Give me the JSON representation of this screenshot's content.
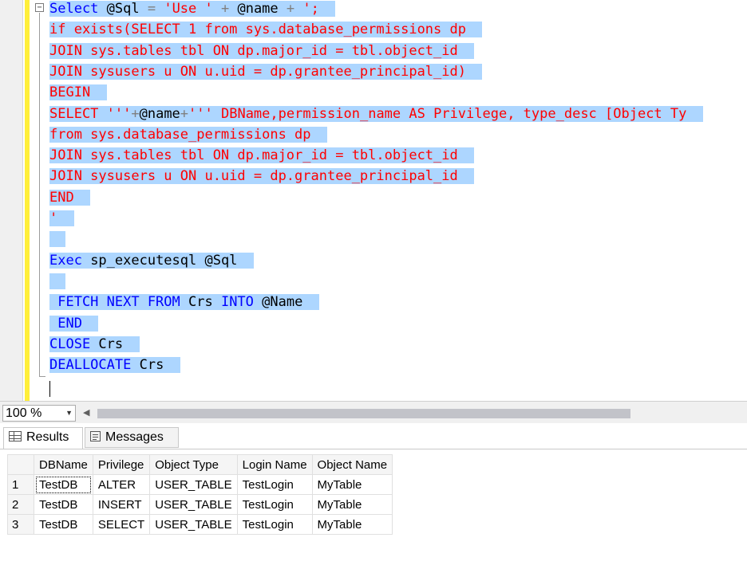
{
  "editor": {
    "outline_toggle": "−",
    "lines": [
      [
        {
          "t": "Select",
          "c": "kw"
        },
        {
          "t": " @Sql ",
          "c": "id"
        },
        {
          "t": "=",
          "c": "op"
        },
        {
          "t": " 'Use ' ",
          "c": "str"
        },
        {
          "t": "+",
          "c": "op"
        },
        {
          "t": " @name ",
          "c": "id"
        },
        {
          "t": "+",
          "c": "op"
        },
        {
          "t": " ';",
          "c": "str"
        }
      ],
      [
        {
          "t": "if exists(SELECT 1 from sys.database_permissions dp",
          "c": "str"
        }
      ],
      [
        {
          "t": "JOIN sys.tables tbl ON dp.major_id = tbl.object_id",
          "c": "str"
        }
      ],
      [
        {
          "t": "JOIN sysusers u ON u.uid = dp.grantee_principal_id)",
          "c": "str"
        }
      ],
      [
        {
          "t": "BEGIN",
          "c": "str"
        }
      ],
      [
        {
          "t": "SELECT '''",
          "c": "str"
        },
        {
          "t": "+",
          "c": "op"
        },
        {
          "t": "@name",
          "c": "id"
        },
        {
          "t": "+",
          "c": "op"
        },
        {
          "t": "''' DBName,permission_name AS Privilege, type_desc [Object Ty",
          "c": "str"
        }
      ],
      [
        {
          "t": "from sys.database_permissions dp",
          "c": "str"
        }
      ],
      [
        {
          "t": "JOIN sys.tables tbl ON dp.major_id = tbl.object_id",
          "c": "str"
        }
      ],
      [
        {
          "t": "JOIN sysusers u ON u.uid = dp.grantee_principal_id",
          "c": "str"
        }
      ],
      [
        {
          "t": "END",
          "c": "str"
        }
      ],
      [
        {
          "t": "'",
          "c": "str"
        }
      ],
      [
        {
          "t": "",
          "c": "id"
        }
      ],
      [
        {
          "t": "Exec",
          "c": "kw"
        },
        {
          "t": " sp_executesql @Sql",
          "c": "id"
        }
      ],
      [
        {
          "t": "",
          "c": "id"
        }
      ],
      [
        {
          "t": " FETCH NEXT FROM",
          "c": "kw"
        },
        {
          "t": " Crs ",
          "c": "id"
        },
        {
          "t": "INTO",
          "c": "kw"
        },
        {
          "t": " @Name",
          "c": "id"
        }
      ],
      [
        {
          "t": " END",
          "c": "kw"
        }
      ],
      [
        {
          "t": "CLOSE",
          "c": "kw"
        },
        {
          "t": " Crs",
          "c": "id"
        }
      ],
      [
        {
          "t": "DEALLOCATE",
          "c": "kw"
        },
        {
          "t": " Crs",
          "c": "id"
        }
      ]
    ]
  },
  "zoom": {
    "value": "100 %",
    "arrow": "▼",
    "scroll_left": "◀"
  },
  "tabs": [
    {
      "label": "Results",
      "icon": "grid-icon"
    },
    {
      "label": "Messages",
      "icon": "messages-icon"
    }
  ],
  "grid": {
    "columns": [
      "DBName",
      "Privilege",
      "Object Type",
      "Login Name",
      "Object Name"
    ],
    "rows": [
      [
        "1",
        "TestDB",
        "ALTER",
        "USER_TABLE",
        "TestLogin",
        "MyTable"
      ],
      [
        "2",
        "TestDB",
        "INSERT",
        "USER_TABLE",
        "TestLogin",
        "MyTable"
      ],
      [
        "3",
        "TestDB",
        "SELECT",
        "USER_TABLE",
        "TestLogin",
        "MyTable"
      ]
    ]
  },
  "colors": {
    "keyword": "#0000ff",
    "string": "#ff0000",
    "selection": "#add6ff",
    "change_bar": "#ffef3a"
  }
}
